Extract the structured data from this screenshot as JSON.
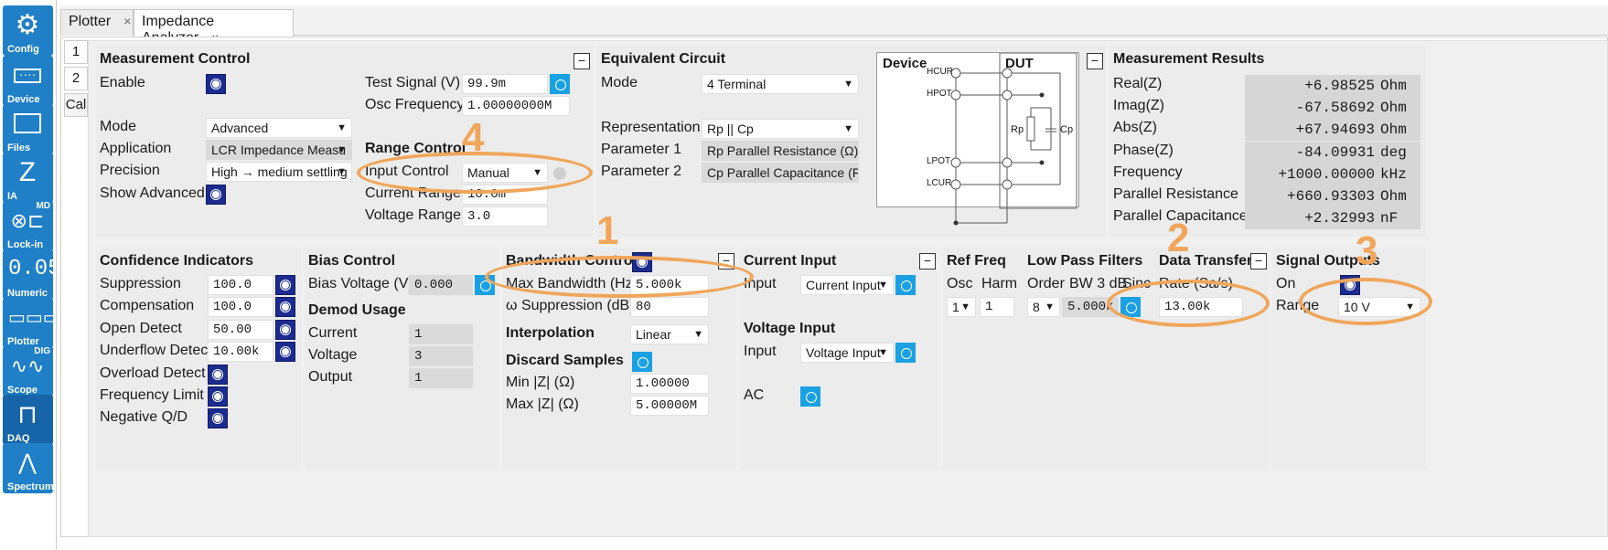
{
  "sidebar": [
    {
      "label": "Config",
      "icon": "gear-icon"
    },
    {
      "label": "Device",
      "icon": "device-icon"
    },
    {
      "label": "Files",
      "icon": "folder-icon"
    },
    {
      "label": "IA",
      "icon": "impedance-icon"
    },
    {
      "label": "Lock-in",
      "icon": "lockin-icon",
      "tag": "MD"
    },
    {
      "label": "Numeric",
      "icon": "numeric-icon"
    },
    {
      "label": "Plotter",
      "icon": "plotter-icon"
    },
    {
      "label": "Scope",
      "icon": "scope-icon",
      "tag": "DIG"
    },
    {
      "label": "DAQ",
      "icon": "daq-icon"
    },
    {
      "label": "Spectrum",
      "icon": "spectrum-icon"
    }
  ],
  "tabs": [
    {
      "label": "Plotter",
      "close": "×"
    },
    {
      "label": "Impedance Analyzer",
      "close": "×"
    }
  ],
  "vtabs": [
    "1",
    "2",
    "Cal"
  ],
  "meas_control": {
    "title": "Measurement Control",
    "enable": "Enable",
    "test_signal": "Test Signal (V)",
    "test_signal_value": "99.9m",
    "osc_freq": "Osc Frequency",
    "osc_freq_value": "1.00000000M",
    "mode": "Mode",
    "mode_value": "Advanced",
    "application": "Application",
    "application_value": "LCR Impedance Measu",
    "precision": "Precision",
    "precision_value": "High → medium settling",
    "show_adv": "Show Advanced",
    "range_title": "Range Control",
    "input_control": "Input Control",
    "input_control_value": "Manual",
    "current_range": "Current Range",
    "current_range_value": "10.0m",
    "voltage_range": "Voltage Range",
    "voltage_range_value": "3.0",
    "minimize": "−"
  },
  "equiv": {
    "title": "Equivalent Circuit",
    "mode": "Mode",
    "mode_value": "4 Terminal",
    "repr": "Representation",
    "repr_value": "Rp || Cp",
    "param1": "Parameter 1",
    "param1_value": "Rp Parallel Resistance (Ω)",
    "param2": "Parameter 2",
    "param2_value": "Cp Parallel Capacitance (F)",
    "device": "Device",
    "dut": "DUT",
    "hcur": "HCUR",
    "hpot": "HPOT",
    "lpot": "LPOT",
    "lcur": "LCUR",
    "rp": "Rp",
    "cp": "Cp",
    "minimize": "−"
  },
  "results": {
    "title": "Measurement Results",
    "rows": [
      {
        "label": "Real(Z)",
        "value": "+6.98525",
        "unit": "Ohm"
      },
      {
        "label": "Imag(Z)",
        "value": "-67.58692",
        "unit": "Ohm"
      },
      {
        "label": "Abs(Z)",
        "value": "+67.94693",
        "unit": "Ohm"
      },
      {
        "label": "Phase(Z)",
        "value": "-84.09931",
        "unit": "deg"
      },
      {
        "label": "Frequency",
        "value": "+1000.00000",
        "unit": "kHz"
      },
      {
        "label": "Parallel Resistance",
        "value": "+660.93303",
        "unit": "Ohm"
      },
      {
        "label": "Parallel Capacitance",
        "value": "+2.32993",
        "unit": "nF"
      }
    ]
  },
  "confidence": {
    "title": "Confidence Indicators",
    "rows": [
      {
        "label": "Suppression",
        "value": "100.0"
      },
      {
        "label": "Compensation",
        "value": "100.0"
      },
      {
        "label": "Open Detect",
        "value": "50.00"
      },
      {
        "label": "Underflow Detect",
        "value": "10.00k"
      },
      {
        "label": "Overload Detect"
      },
      {
        "label": "Frequency Limit"
      },
      {
        "label": "Negative Q/D"
      }
    ]
  },
  "bias": {
    "title": "Bias Control",
    "voltage": "Bias Voltage (V)",
    "voltage_value": "0.000",
    "demod_title": "Demod Usage",
    "current": "Current",
    "current_value": "1",
    "voltage_l": "Voltage",
    "voltage_value2": "3",
    "output": "Output",
    "output_value": "1"
  },
  "bandwidth": {
    "title": "Bandwidth Control",
    "max_bw": "Max Bandwidth (Hz)",
    "max_bw_value": "5.000k",
    "omega": "ω Suppression (dB)",
    "omega_value": "80",
    "interp": "Interpolation",
    "interp_value": "Linear",
    "discard": "Discard Samples",
    "minz": "Min |Z| (Ω)",
    "minz_value": "1.00000",
    "maxz": "Max |Z| (Ω)",
    "maxz_value": "5.00000M",
    "minimize": "−"
  },
  "current_input": {
    "title": "Current Input",
    "input": "Input",
    "input_value": "Current Input",
    "vtitle": "Voltage Input",
    "vinput": "Input",
    "vinput_value": "Voltage Input",
    "ac": "AC",
    "minimize": "−"
  },
  "ref": {
    "title": "Ref Freq",
    "osc": "Osc",
    "harm": "Harm",
    "osc_value": "1",
    "harm_value": "1"
  },
  "lpf": {
    "title": "Low Pass Filters",
    "order": "Order",
    "bw": "BW 3 dB",
    "sinc": "Sinc",
    "order_value": "8",
    "bw_value": "5.000k"
  },
  "data_transfer": {
    "title": "Data Transfer",
    "rate": "Rate (Sa/s)",
    "rate_value": "13.00k",
    "minimize": "−"
  },
  "signal_output": {
    "title": "Signal Outputs",
    "on": "On",
    "range": "Range",
    "range_value": "10 V"
  },
  "annotations": [
    "1",
    "2",
    "3",
    "4"
  ],
  "colors": {
    "accent": "#1f7fc7",
    "checkbox_on": "#1b2b8f",
    "checkbox_off": "#1aa1e3",
    "annotation": "#f0a65a"
  }
}
